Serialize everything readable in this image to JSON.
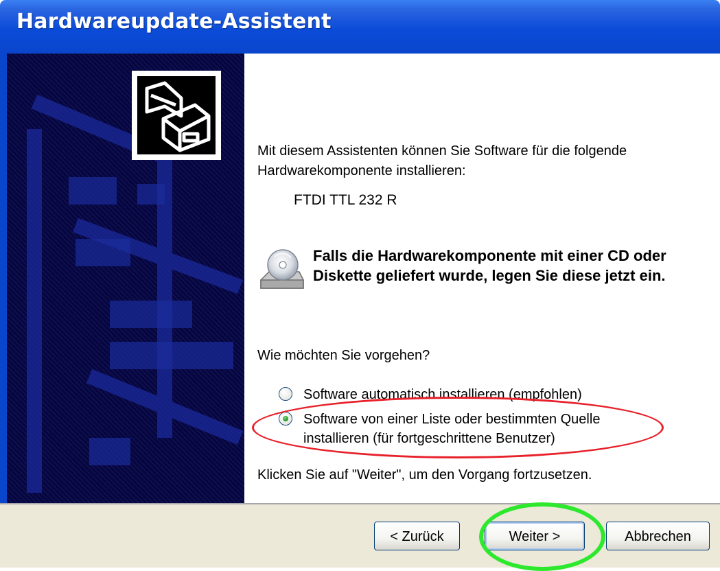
{
  "window": {
    "title": "Hardwareupdate-Assistent"
  },
  "intro": {
    "text": "Mit diesem Assistenten können Sie Software für die folgende Hardwarekomponente installieren:",
    "device_name": "FTDI TTL 232 R"
  },
  "cd_notice": {
    "text": "Falls die Hardwarekomponente mit einer CD oder Diskette geliefert wurde, legen Sie diese jetzt ein."
  },
  "options": {
    "question": "Wie möchten Sie vorgehen?",
    "choices": [
      {
        "label": "Software automatisch installieren (empfohlen)",
        "selected": false
      },
      {
        "label": "Software von einer Liste oder bestimmten Quelle installieren (für fortgeschrittene Benutzer)",
        "selected": true
      }
    ]
  },
  "instruction": {
    "text": "Klicken Sie auf \"Weiter\", um den Vorgang fortzusetzen."
  },
  "buttons": {
    "back": "< Zurück",
    "next": "Weiter >",
    "cancel": "Abbrechen"
  },
  "annotations": {
    "red_circle_color": "#e8202a",
    "green_circle_color": "#2ee82e"
  },
  "icons": {
    "wizard_image": "hardware-card-icon",
    "cd_drive": "cd-drive-icon"
  },
  "colors": {
    "titlebar": "#0a46cc",
    "left_panel": "#05053f",
    "footer": "#ece9d8"
  }
}
